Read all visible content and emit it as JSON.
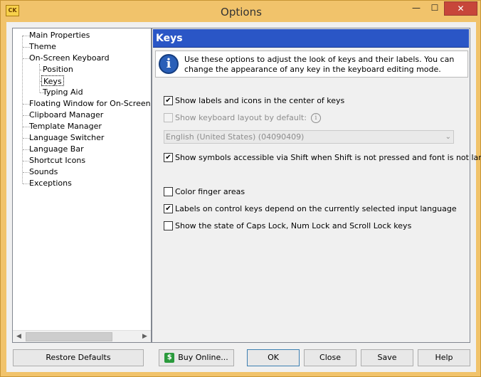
{
  "window": {
    "title": "Options",
    "app_icon_label": "CK",
    "minimize_glyph": "—",
    "maximize_glyph": "☐",
    "close_glyph": "✕"
  },
  "tree": {
    "items": [
      {
        "label": "Main Properties"
      },
      {
        "label": "Theme"
      },
      {
        "label": "On-Screen Keyboard"
      },
      {
        "label": "Position"
      },
      {
        "label": "Keys"
      },
      {
        "label": "Typing Aid"
      },
      {
        "label": "Floating Window for On-Screen Ke"
      },
      {
        "label": "Clipboard Manager"
      },
      {
        "label": "Template Manager"
      },
      {
        "label": "Language Switcher"
      },
      {
        "label": "Language Bar"
      },
      {
        "label": "Shortcut Icons"
      },
      {
        "label": "Sounds"
      },
      {
        "label": "Exceptions"
      }
    ],
    "selected": "Keys",
    "scroll_left_glyph": "◀",
    "scroll_right_glyph": "▶"
  },
  "panel": {
    "title": "Keys",
    "info_glyph": "i",
    "info_text": "Use these options to adjust the look of keys and their labels. You can change the appearance of any key in the keyboard editing mode.",
    "options": [
      {
        "label": "Show labels and icons in the center of keys",
        "checked": true,
        "enabled": true
      },
      {
        "label": "Show keyboard layout by default:",
        "checked": false,
        "enabled": false
      },
      {
        "label": "Show symbols accessible via Shift when Shift is not pressed and font is not large",
        "checked": true,
        "enabled": true
      },
      {
        "label": "Color finger areas",
        "checked": false,
        "enabled": true
      },
      {
        "label": "Labels on control keys depend on the currently selected input language",
        "checked": true,
        "enabled": true
      },
      {
        "label": "Show the state of Caps Lock, Num Lock and Scroll Lock keys",
        "checked": false,
        "enabled": true
      }
    ],
    "help_glyph": "i",
    "layout_dropdown": {
      "value": "English (United States) (04090409)",
      "arrow_glyph": "⌄"
    },
    "check_glyph": "✔"
  },
  "buttons": {
    "restore": "Restore Defaults",
    "buy": "Buy Online...",
    "buy_icon_glyph": "$",
    "ok": "OK",
    "close": "Close",
    "save": "Save",
    "help": "Help"
  },
  "colors": {
    "titlebar": "#f1c36b",
    "header": "#2a56c6",
    "close_button": "#c7463a",
    "info_icon": "#2a5fb8"
  }
}
